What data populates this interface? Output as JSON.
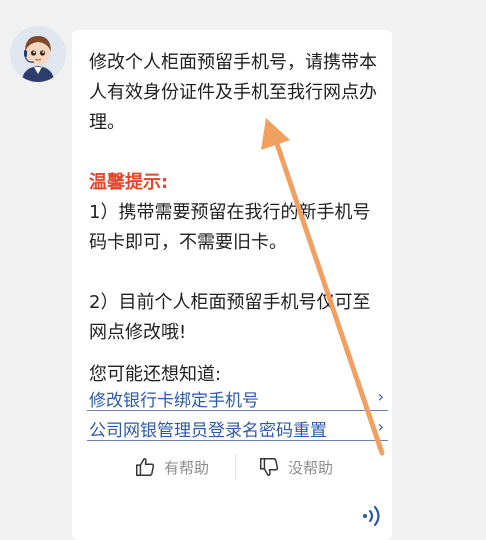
{
  "message": {
    "intro_line1": "修改个人柜面预留手机号，请携带本",
    "intro_line2": "人有效身份证件及手机至我行网点办",
    "intro_line3": "理。",
    "tip_title": "温馨提示:",
    "tip1_line1": "1）携带需要预留在我行的新手机号",
    "tip1_line2": "码卡即可，不需要旧卡。",
    "tip2_line1": "2）目前个人柜面预留手机号仅可至",
    "tip2_line2": "网点修改哦!"
  },
  "suggestions": {
    "title": "您可能还想知道:",
    "items": [
      {
        "label": "修改银行卡绑定手机号"
      },
      {
        "label": "公司网银管理员登录名密码重置"
      }
    ]
  },
  "feedback": {
    "helpful": "有帮助",
    "not_helpful": "没帮助"
  },
  "icons": {
    "avatar": "agent-avatar",
    "thumb_up": "thumbs-up-icon",
    "thumb_down": "thumbs-down-icon",
    "sound": "sound-icon",
    "chevron": "chevron-right-icon"
  },
  "colors": {
    "tip": "#e0472d",
    "link": "#2c5aa8",
    "annotation_arrow": "#f0a060"
  }
}
